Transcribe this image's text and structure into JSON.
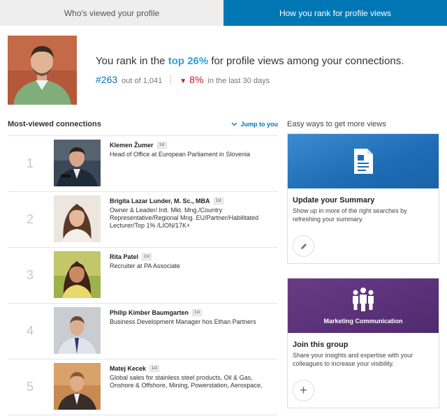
{
  "tabs": [
    {
      "label": "Who's viewed your profile"
    },
    {
      "label": "How you rank for profile views"
    }
  ],
  "rank": {
    "prefix": "You rank in the ",
    "highlight": "top 26%",
    "suffix": " for profile views among your connections.",
    "number": "#263",
    "out_of": "out of 1,041",
    "change": "8%",
    "period": "in the last 30 days"
  },
  "most_viewed": {
    "title": "Most-viewed connections",
    "jump": "Jump to you",
    "connections": [
      {
        "rank": "1",
        "name": "Klemen Žumer",
        "degree": "1st",
        "title": "Head of Office at European Parliament in Slovenia"
      },
      {
        "rank": "2",
        "name": "Brigita Lazar Lunder, M. Sc., MBA",
        "degree": "1st",
        "title": "Owner & Leader/ Intl. Mkt. Mng./Country Representative/Regional Mng. EU/Partner/Habilitated Lecturer/Top 1% /LION/17K+"
      },
      {
        "rank": "3",
        "name": "Rita Patel",
        "degree": "1st",
        "title": "Recruiter at PA Associate"
      },
      {
        "rank": "4",
        "name": "Philip Kimber Baumgarten",
        "degree": "1st",
        "title": "Business Development Manager hos Ethan Partners"
      },
      {
        "rank": "5",
        "name": "Matej Kecek",
        "degree": "1st",
        "title": "Global sales for stainless steel products, Oil & Gas, Onshore & Offshore, Mining, Powerstation, Aerospace,"
      }
    ]
  },
  "easy_ways": {
    "title": "Easy ways to get more views",
    "cards": [
      {
        "heading": "Update your Summary",
        "desc": "Show up in more of the right searches by refreshing your summary.",
        "banner_caption": "",
        "icon": "document-icon",
        "button_icon": "pencil-icon"
      },
      {
        "heading": "Join this group",
        "desc": "Share your insights and expertise with your colleagues to increase your visibility.",
        "banner_caption": "Marketing Communication",
        "icon": "people-icon",
        "button_icon": "plus-icon"
      }
    ]
  },
  "colors": {
    "accent": "#0077b5",
    "highlight": "#2f9fd8",
    "negative": "#d11124"
  }
}
